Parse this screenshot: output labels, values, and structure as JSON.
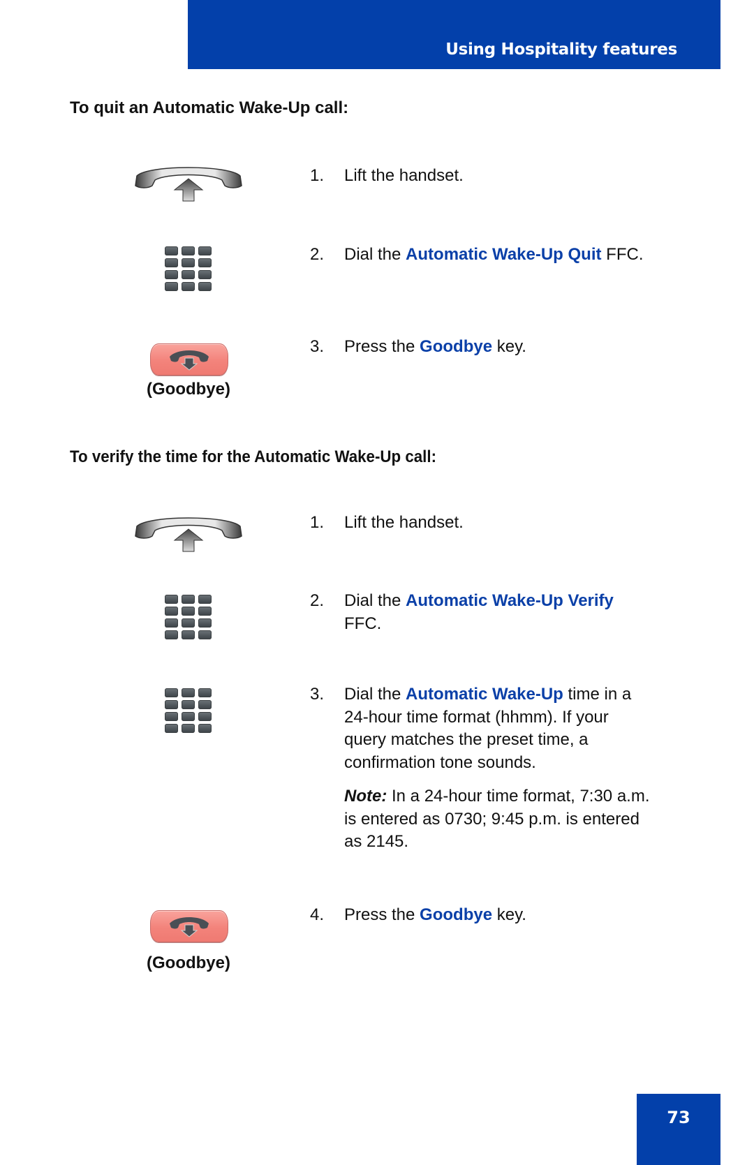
{
  "header": {
    "title": "Using Hospitality features"
  },
  "sections": [
    {
      "heading": "To quit an Automatic Wake-Up call:",
      "steps": [
        {
          "num": "1.",
          "text": "Lift the handset.",
          "icon": "handset-lift-icon"
        },
        {
          "num": "2.",
          "pre": "Dial the ",
          "highlight": "Automatic Wake-Up Quit",
          "post": " FFC.",
          "icon": "dialpad-icon"
        },
        {
          "num": "3.",
          "pre": "Press the ",
          "highlight": "Goodbye",
          "post": " key.",
          "icon": "goodbye-key-icon",
          "icon_label": "(Goodbye)"
        }
      ]
    },
    {
      "heading": "To verify the time for the Automatic Wake-Up call:",
      "steps": [
        {
          "num": "1.",
          "text": "Lift the handset.",
          "icon": "handset-lift-icon"
        },
        {
          "num": "2.",
          "pre": "Dial the ",
          "highlight": "Automatic Wake-Up Verify",
          "post": " FFC.",
          "icon": "dialpad-icon"
        },
        {
          "num": "3.",
          "pre": "Dial the ",
          "highlight": "Automatic Wake-Up",
          "post": " time in a 24-hour time format (hhmm). If your query matches the preset time, a confirmation tone sounds.",
          "icon": "dialpad-icon",
          "note_label": "Note:",
          "note_text": " In a 24-hour time format, 7:30 a.m. is entered as 0730; 9:45 p.m. is entered as 2145."
        },
        {
          "num": "4.",
          "pre": "Press the ",
          "highlight": "Goodbye",
          "post": " key.",
          "icon": "goodbye-key-icon",
          "icon_label": "(Goodbye)"
        }
      ]
    }
  ],
  "footer": {
    "page_number": "73"
  },
  "colors": {
    "brand_blue": "#0340aa",
    "link_blue": "#0b40a8",
    "goodbye_key": "#f3837b"
  }
}
